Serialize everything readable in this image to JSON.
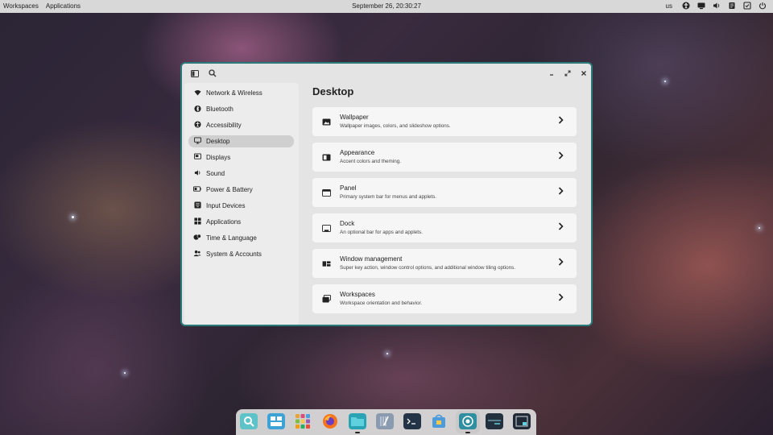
{
  "topbar": {
    "workspaces": "Workspaces",
    "applications": "Applications",
    "clock": "September 26, 20:30:27",
    "keyboard_layout": "us"
  },
  "window": {
    "sidebar": [
      {
        "label": "Network & Wireless",
        "icon": "wifi-icon"
      },
      {
        "label": "Bluetooth",
        "icon": "bluetooth-icon"
      },
      {
        "label": "Accessibility",
        "icon": "accessibility-icon"
      },
      {
        "label": "Desktop",
        "icon": "desktop-icon",
        "active": true
      },
      {
        "label": "Displays",
        "icon": "display-icon"
      },
      {
        "label": "Sound",
        "icon": "sound-icon"
      },
      {
        "label": "Power & Battery",
        "icon": "battery-icon"
      },
      {
        "label": "Input Devices",
        "icon": "keyboard-icon"
      },
      {
        "label": "Applications",
        "icon": "apps-grid-icon"
      },
      {
        "label": "Time & Language",
        "icon": "time-language-icon"
      },
      {
        "label": "System & Accounts",
        "icon": "accounts-icon"
      }
    ],
    "page_title": "Desktop",
    "cards": [
      {
        "title": "Wallpaper",
        "desc": "Wallpaper images, colors, and slideshow options.",
        "icon": "wallpaper-icon"
      },
      {
        "title": "Appearance",
        "desc": "Accent colors and theming.",
        "icon": "appearance-icon"
      },
      {
        "title": "Panel",
        "desc": "Primary system bar for menus and applets.",
        "icon": "panel-icon"
      },
      {
        "title": "Dock",
        "desc": "An optional bar for apps and applets.",
        "icon": "dock-icon"
      },
      {
        "title": "Window management",
        "desc": "Super key action, window control options, and additional window tiling options.",
        "icon": "window-management-icon"
      },
      {
        "title": "Workspaces",
        "desc": "Workspace orientation and behavior.",
        "icon": "workspaces-icon"
      }
    ]
  },
  "colors": {
    "window_border": "#2b7a7a",
    "topbar_bg": "#d8d8d8",
    "active_item_bg": "#cfcfcf"
  }
}
